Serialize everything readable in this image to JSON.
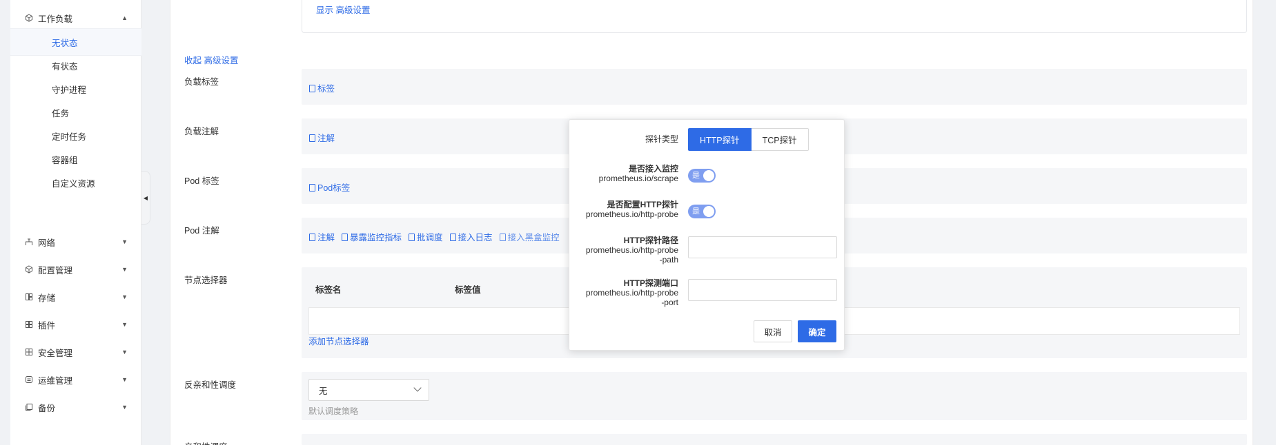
{
  "sidebar": {
    "workload": {
      "label": "工作负载"
    },
    "sub_items": [
      "无状态",
      "有状态",
      "守护进程",
      "任务",
      "定时任务",
      "容器组",
      "自定义资源"
    ],
    "groups": [
      {
        "label": "网络",
        "icon": "network-icon"
      },
      {
        "label": "配置管理",
        "icon": "config-icon"
      },
      {
        "label": "存储",
        "icon": "storage-icon"
      },
      {
        "label": "插件",
        "icon": "plugin-icon"
      },
      {
        "label": "安全管理",
        "icon": "security-icon"
      },
      {
        "label": "运维管理",
        "icon": "ops-icon"
      },
      {
        "label": "备份",
        "icon": "backup-icon"
      }
    ]
  },
  "main": {
    "show_advanced": "显示 高级设置",
    "collapse_advanced": "收起 高级设置",
    "labels": {
      "workload_labels": "负载标签",
      "workload_annotations": "负载注解",
      "pod_labels": "Pod 标签",
      "pod_annotations": "Pod 注解",
      "node_selector": "节点选择器",
      "anti_affinity": "反亲和性调度",
      "affinity": "亲和性调度"
    },
    "links": {
      "tag": "标签",
      "annotation": "注解",
      "pod_tag": "Pod标签",
      "pod_annotation_links": [
        "注解",
        "暴露监控指标",
        "批调度",
        "接入日志",
        "接入黑盒监控"
      ]
    },
    "node_selector_table": {
      "columns": [
        "标签名",
        "标签值"
      ],
      "add_link": "添加节点选择器"
    },
    "anti_affinity_select": {
      "value": "无",
      "hint": "默认调度策略"
    }
  },
  "popover": {
    "probe_type_label": "探针类型",
    "probe_types": [
      "HTTP探针",
      "TCP探针"
    ],
    "selected_probe": "HTTP探针",
    "fields": [
      {
        "title": "是否接入监控",
        "key": "prometheus.io/scrape",
        "toggle": "是"
      },
      {
        "title": "是否配置HTTP探针",
        "key": "prometheus.io/http-probe",
        "toggle": "是"
      },
      {
        "title": "HTTP探针路径",
        "key_lines": [
          "prometheus.io/http-probe",
          "-path"
        ]
      },
      {
        "title": "HTTP探测端口",
        "key_lines": [
          "prometheus.io/http-probe",
          "-port"
        ]
      }
    ],
    "cancel": "取消",
    "confirm": "确定"
  },
  "colors": {
    "primary": "#2e6be6",
    "toggle_on": "#7f9ef0"
  }
}
